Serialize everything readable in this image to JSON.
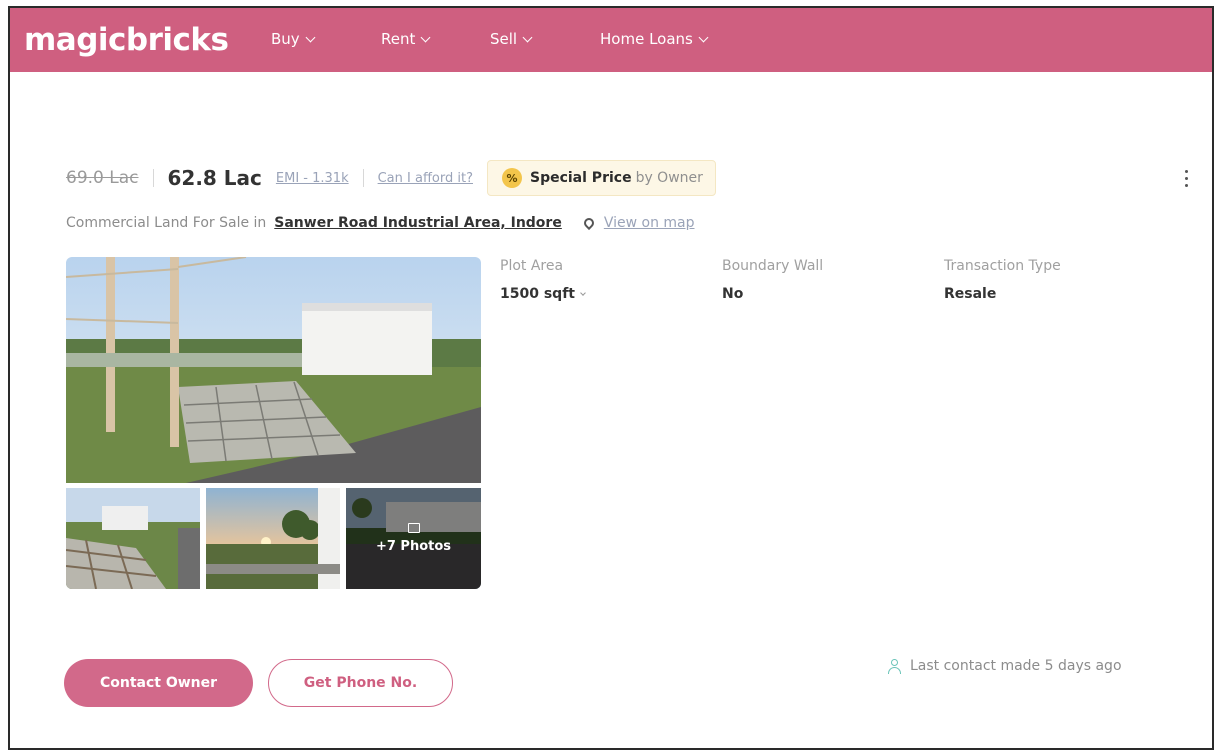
{
  "navbar": {
    "logo": "magicbricks",
    "items": [
      {
        "label": "Buy"
      },
      {
        "label": "Rent"
      },
      {
        "label": "Sell"
      },
      {
        "label": "Home Loans"
      }
    ],
    "color": "#cf5f80"
  },
  "listing": {
    "old_price": "69.0 Lac",
    "price": "62.8 Lac",
    "emi": "EMI - 1.31k",
    "afford": "Can I afford it?",
    "special_icon": "%",
    "special_strong": "Special Price",
    "special_by": "by Owner",
    "title_prefix": "Commercial Land For Sale in",
    "locality": "Sanwer Road Industrial Area, Indore",
    "view_map": "View on map",
    "more_photos": "+7 Photos",
    "specs": [
      {
        "label": "Plot Area",
        "value": "1500 sqft"
      },
      {
        "label": "Boundary Wall",
        "value": "No"
      },
      {
        "label": "Transaction Type",
        "value": "Resale"
      }
    ]
  },
  "actions": {
    "contact_owner": "Contact Owner",
    "get_phone": "Get Phone No.",
    "last_contact": "Last contact made 5 days ago"
  },
  "icons": {
    "pin": "location-pin-icon",
    "kebab": "more-options-icon",
    "person": "person-icon",
    "gallery": "gallery-icon"
  },
  "colors": {
    "brand": "#cf5f80",
    "button": "#d2698a",
    "special_bg": "#fdf7e6",
    "badge": "#f3c54b",
    "person_icon": "#6ac4b8"
  }
}
